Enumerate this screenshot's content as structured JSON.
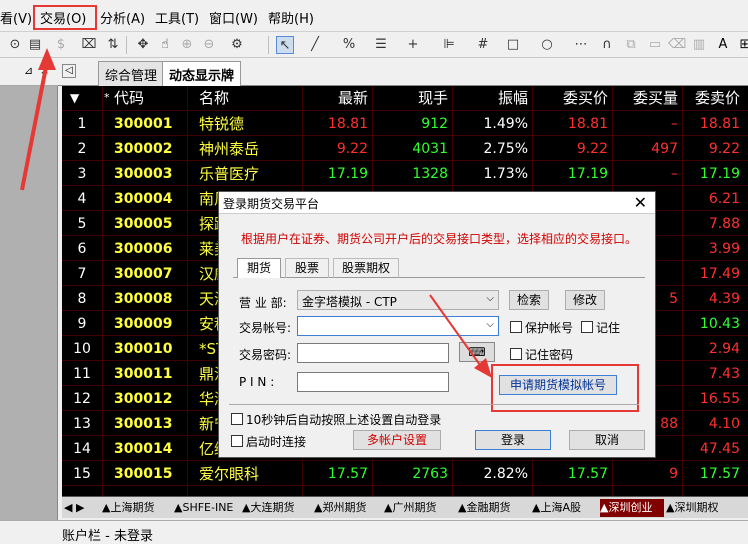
{
  "menubar": {
    "items": [
      {
        "label": "看(V)"
      },
      {
        "label": "交易(O)"
      },
      {
        "label": "分析(A)"
      },
      {
        "label": "工具(T)"
      },
      {
        "label": "窗口(W)"
      },
      {
        "label": "帮助(H)"
      }
    ]
  },
  "tabs": [
    {
      "label": "综合管理"
    },
    {
      "label": "动态显示牌"
    }
  ],
  "grid": {
    "headers": [
      "代码",
      "名称",
      "最新",
      "现手",
      "振幅",
      "委买价",
      "委买量",
      "委卖价"
    ],
    "rows": [
      {
        "idx": "1",
        "code": "300001",
        "name": "特锐德",
        "last": "18.81",
        "vol": "912",
        "amp": "1.49%",
        "bid": "18.81",
        "bidvol": "–",
        "ask": "18.81",
        "last_color": "#ff3030",
        "vol_color": "#30ff30",
        "bid_color": "#ff3030",
        "ask_color": "#ff3030",
        "bidvol_color": "#ff3030"
      },
      {
        "idx": "2",
        "code": "300002",
        "name": "神州泰岳",
        "last": "9.22",
        "vol": "4031",
        "amp": "2.75%",
        "bid": "9.22",
        "bidvol": "497",
        "ask": "9.22",
        "last_color": "#ff3030",
        "vol_color": "#30ff30",
        "bid_color": "#ff3030",
        "ask_color": "#ff3030",
        "bidvol_color": "#ff3030"
      },
      {
        "idx": "3",
        "code": "300003",
        "name": "乐普医疗",
        "last": "17.19",
        "vol": "1328",
        "amp": "1.73%",
        "bid": "17.19",
        "bidvol": "–",
        "ask": "17.19",
        "last_color": "#30ff30",
        "vol_color": "#30ff30",
        "bid_color": "#30ff30",
        "ask_color": "#30ff30",
        "bidvol_color": "#ff3030"
      },
      {
        "idx": "4",
        "code": "300004",
        "name": "南风",
        "last": "",
        "vol": "",
        "amp": "",
        "bid": "",
        "bidvol": "",
        "ask": "6.21",
        "last_color": "#ff3030",
        "vol_color": "#30ff30",
        "bid_color": "#ff3030",
        "ask_color": "#ff3030",
        "bidvol_color": "#ff3030"
      },
      {
        "idx": "5",
        "code": "300005",
        "name": "探路",
        "last": "",
        "vol": "",
        "amp": "",
        "bid": "",
        "bidvol": "",
        "ask": "7.88",
        "last_color": "#ff3030",
        "vol_color": "#30ff30",
        "bid_color": "#ff3030",
        "ask_color": "#ff3030",
        "bidvol_color": "#ff3030"
      },
      {
        "idx": "6",
        "code": "300006",
        "name": "莱美",
        "last": "",
        "vol": "",
        "amp": "",
        "bid": "",
        "bidvol": "",
        "ask": "3.99",
        "last_color": "#ff3030",
        "vol_color": "#30ff30",
        "bid_color": "#ff3030",
        "ask_color": "#ff3030",
        "bidvol_color": "#ff3030"
      },
      {
        "idx": "7",
        "code": "300007",
        "name": "汉威",
        "last": "",
        "vol": "",
        "amp": "",
        "bid": "",
        "bidvol": "",
        "ask": "17.49",
        "last_color": "#ff3030",
        "vol_color": "#30ff30",
        "bid_color": "#ff3030",
        "ask_color": "#ff3030",
        "bidvol_color": "#ff3030"
      },
      {
        "idx": "8",
        "code": "300008",
        "name": "天海",
        "last": "",
        "vol": "",
        "amp": "",
        "bid": "",
        "bidvol": "5",
        "ask": "4.39",
        "last_color": "#ff3030",
        "vol_color": "#30ff30",
        "bid_color": "#ff3030",
        "ask_color": "#ff3030",
        "bidvol_color": "#ff3030"
      },
      {
        "idx": "9",
        "code": "300009",
        "name": "安科",
        "last": "",
        "vol": "",
        "amp": "",
        "bid": "",
        "bidvol": "",
        "ask": "10.43",
        "last_color": "#30ff30",
        "vol_color": "#30ff30",
        "bid_color": "#30ff30",
        "ask_color": "#30ff30",
        "bidvol_color": "#ff3030"
      },
      {
        "idx": "10",
        "code": "300010",
        "name": "*ST",
        "last": "",
        "vol": "",
        "amp": "",
        "bid": "",
        "bidvol": "",
        "ask": "2.94",
        "last_color": "#ff3030",
        "vol_color": "#30ff30",
        "bid_color": "#ff3030",
        "ask_color": "#ff3030",
        "bidvol_color": "#ff3030"
      },
      {
        "idx": "11",
        "code": "300011",
        "name": "鼎汉",
        "last": "",
        "vol": "",
        "amp": "",
        "bid": "",
        "bidvol": "",
        "ask": "7.43",
        "last_color": "#ff3030",
        "vol_color": "#30ff30",
        "bid_color": "#ff3030",
        "ask_color": "#ff3030",
        "bidvol_color": "#ff3030"
      },
      {
        "idx": "12",
        "code": "300012",
        "name": "华测",
        "last": "",
        "vol": "",
        "amp": "",
        "bid": "",
        "bidvol": "",
        "ask": "16.55",
        "last_color": "#ff3030",
        "vol_color": "#30ff30",
        "bid_color": "#ff3030",
        "ask_color": "#ff3030",
        "bidvol_color": "#ff3030"
      },
      {
        "idx": "13",
        "code": "300013",
        "name": "新宁",
        "last": "",
        "vol": "",
        "amp": "",
        "bid": "",
        "bidvol": "88",
        "ask": "4.10",
        "last_color": "#ff3030",
        "vol_color": "#30ff30",
        "bid_color": "#ff3030",
        "ask_color": "#ff3030",
        "bidvol_color": "#ff3030"
      },
      {
        "idx": "14",
        "code": "300014",
        "name": "亿纬",
        "last": "",
        "vol": "",
        "amp": "",
        "bid": "",
        "bidvol": "",
        "ask": "47.45",
        "last_color": "#ff3030",
        "vol_color": "#30ff30",
        "bid_color": "#ff3030",
        "ask_color": "#ff3030",
        "bidvol_color": "#ff3030"
      },
      {
        "idx": "15",
        "code": "300015",
        "name": "爱尔眼科",
        "last": "17.57",
        "vol": "2763",
        "amp": "2.82%",
        "bid": "17.57",
        "bidvol": "9",
        "ask": "17.57",
        "last_color": "#30ff30",
        "vol_color": "#30ff30",
        "bid_color": "#30ff30",
        "ask_color": "#30ff30",
        "bidvol_color": "#ff3030"
      }
    ]
  },
  "bottom_tabs": [
    {
      "label": "▲上海期货"
    },
    {
      "label": "▲SHFE-INE"
    },
    {
      "label": "▲大连期货"
    },
    {
      "label": "▲郑州期货"
    },
    {
      "label": "▲广州期货"
    },
    {
      "label": "▲金融期货"
    },
    {
      "label": "▲上海A股"
    },
    {
      "label": "▲深圳创业"
    },
    {
      "label": "▲深圳期权"
    }
  ],
  "statusbar": {
    "label": "账户栏 - 未登录"
  },
  "dialog": {
    "title": "登录期货交易平台",
    "notice": "根据用户在证券、期货公司开户后的交易接口类型，选择相应的交易接口。",
    "tabs": [
      "期货",
      "股票",
      "股票期权"
    ],
    "branch_label": "营 业 部:",
    "branch_value": "金字塔模拟 - CTP",
    "search_button": "检索",
    "modify_button": "修改",
    "account_label": "交易帐号:",
    "account_value": "",
    "protect_account_label": "保护帐号",
    "remember_label": "记住",
    "password_label": "交易密码:",
    "password_value": "",
    "remember_password_label": "记住密码",
    "pin_label": "P I N :",
    "pin_value": "",
    "apply_button": "申请期货模拟帐号",
    "auto_login_label": "10秒钟后自动按照上述设置自动登录",
    "startup_label": "启动时连接",
    "multi_account_button": "多帐户设置",
    "login_button": "登录",
    "cancel_button": "取消"
  },
  "colors": {
    "highlight_red": "#e53935",
    "code_yellow": "#ffff40",
    "up_red": "#ff3030",
    "down_green": "#30ff30",
    "active_tab": "#800000"
  }
}
